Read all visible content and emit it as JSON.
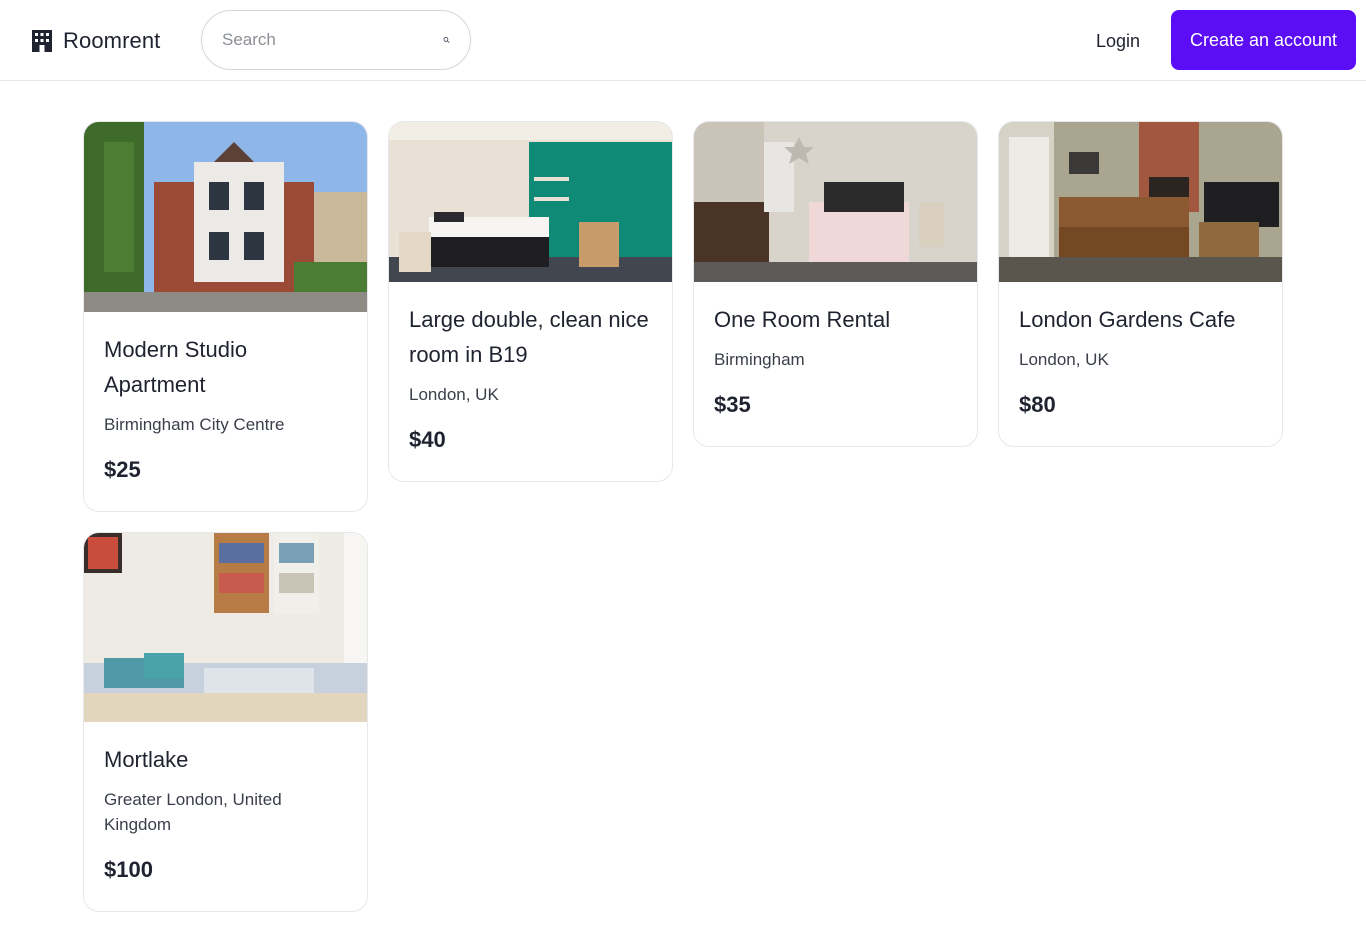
{
  "brand": {
    "name": "Roomrent",
    "icon": "building-icon"
  },
  "search": {
    "placeholder": "Search",
    "value": "",
    "icon": "search-icon"
  },
  "nav": {
    "login_label": "Login",
    "signup_label": "Create an account"
  },
  "colors": {
    "accent": "#5b0df5",
    "text": "#1f2330",
    "border": "#e5e7eb"
  },
  "listings": [
    {
      "title": "Modern Studio Apartment",
      "location": "Birmingham City Centre",
      "price": "$25"
    },
    {
      "title": "Large double, clean nice room in B19",
      "location": "London, UK",
      "price": "$40"
    },
    {
      "title": "One Room Rental",
      "location": "Birmingham",
      "price": "$35"
    },
    {
      "title": "London Gardens Cafe",
      "location": "London, UK",
      "price": "$80"
    },
    {
      "title": "Mortlake",
      "location": "Greater London, United Kingdom",
      "price": "$100"
    }
  ]
}
